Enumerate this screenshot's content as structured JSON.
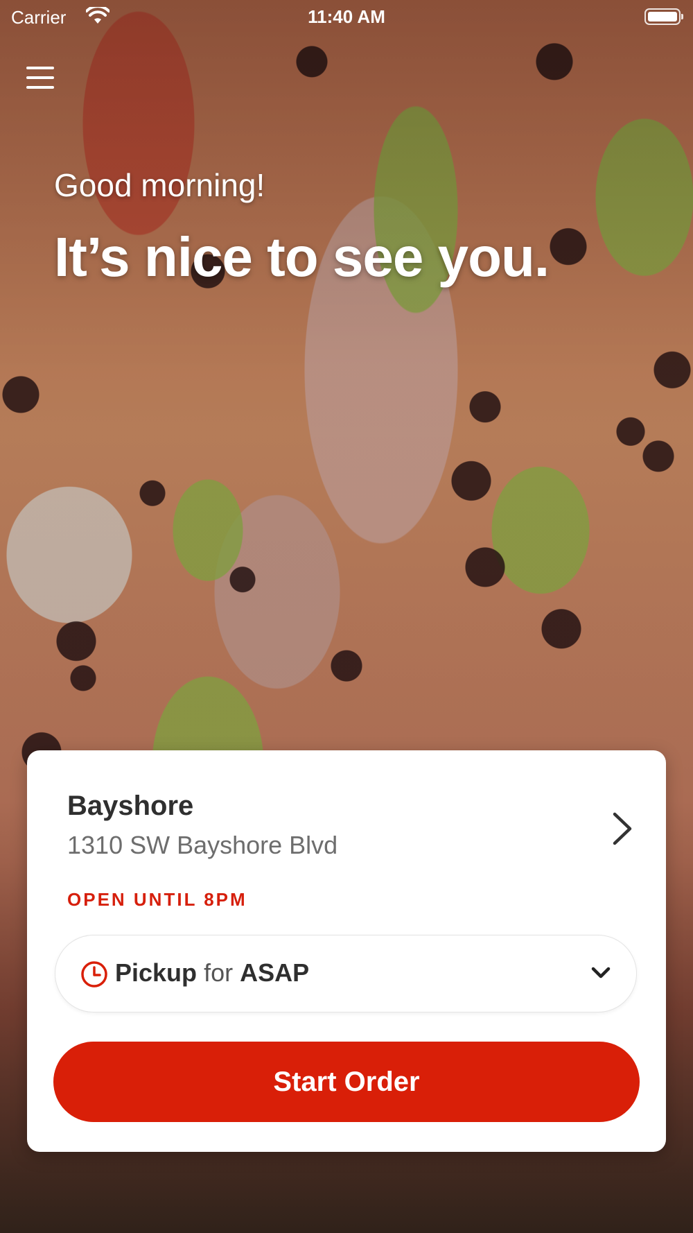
{
  "status_bar": {
    "carrier": "Carrier",
    "time": "11:40 AM"
  },
  "hero": {
    "greeting": "Good morning!",
    "headline": "It’s nice to see you."
  },
  "location": {
    "name": "Bayshore",
    "address": "1310 SW Bayshore Blvd",
    "status": "OPEN UNTIL 8PM"
  },
  "order_mode": {
    "mode": "Pickup",
    "connector": "for",
    "time": "ASAP"
  },
  "actions": {
    "start_order": "Start Order"
  },
  "colors": {
    "accent": "#d91f08",
    "status_text": "#d61f0c",
    "card_background": "#ffffff"
  },
  "icons": {
    "menu": "hamburger-menu-icon",
    "location_chevron": "chevron-right-icon",
    "clock": "clock-icon",
    "dropdown": "chevron-down-icon"
  }
}
